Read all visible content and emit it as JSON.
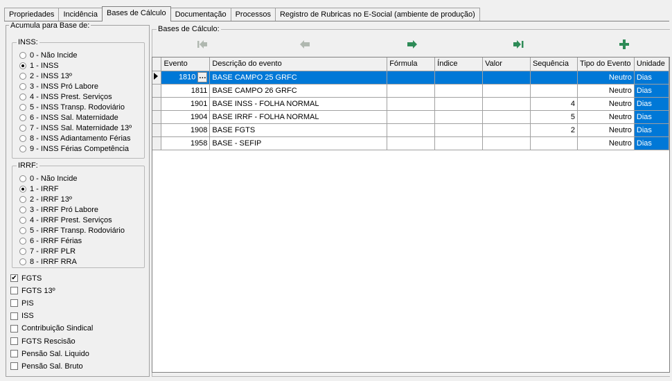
{
  "tabs": [
    {
      "label": "Propriedades"
    },
    {
      "label": "Incidência"
    },
    {
      "label": "Bases de Cálculo"
    },
    {
      "label": "Documentação"
    },
    {
      "label": "Processos"
    },
    {
      "label": "Registro de Rubricas no E-Social (ambiente de produção)"
    }
  ],
  "left": {
    "title": "Acumula para Base de:",
    "inss": {
      "title": "INSS:",
      "options": [
        "0 - Não Incide",
        "1 - INSS",
        "2 - INSS 13º",
        "3 - INSS Pró Labore",
        "4 - INSS Prest. Serviços",
        "5 - INSS Transp. Rodoviário",
        "6 - INSS Sal. Maternidade",
        "7 - INSS Sal. Maternidade 13º",
        "8 - INSS Adiantamento Férias",
        "9 - INSS Férias Competência"
      ],
      "selected": 1
    },
    "irrf": {
      "title": "IRRF:",
      "options": [
        "0 - Não Incide",
        "1 - IRRF",
        "2 - IRRF 13º",
        "3 - IRRF Pró Labore",
        "4 - IRRF Prest. Serviços",
        "5 - IRRF Transp. Rodoviário",
        "6 - IRRF Férias",
        "7 - IRRF PLR",
        "8 - IRRF RRA"
      ],
      "selected": 1
    },
    "checks": [
      {
        "label": "FGTS",
        "checked": true
      },
      {
        "label": "FGTS 13º",
        "checked": false
      },
      {
        "label": "PIS",
        "checked": false
      },
      {
        "label": "ISS",
        "checked": false
      },
      {
        "label": "Contribuição Sindical",
        "checked": false
      },
      {
        "label": "FGTS Rescisão",
        "checked": false
      },
      {
        "label": "Pensão Sal. Liquido",
        "checked": false
      },
      {
        "label": "Pensão Sal. Bruto",
        "checked": false
      }
    ]
  },
  "right": {
    "title": "Bases de Cálculo:",
    "nav_icons": [
      "first-record-icon",
      "prior-record-icon",
      "next-record-icon",
      "last-record-icon",
      "add-record-icon"
    ],
    "columns": [
      "Evento",
      "Descrição do evento",
      "Fórmula",
      "Índice",
      "Valor",
      "Sequência",
      "Tipo do Evento",
      "Unidade"
    ],
    "rows": [
      {
        "evento": "1810",
        "descricao": "BASE CAMPO 25 GRFC",
        "formula": "",
        "indice": "",
        "valor": "",
        "sequencia": "",
        "tipo": "Neutro",
        "unidade": "Dias"
      },
      {
        "evento": "1811",
        "descricao": "BASE CAMPO 26 GRFC",
        "formula": "",
        "indice": "",
        "valor": "",
        "sequencia": "",
        "tipo": "Neutro",
        "unidade": "Dias"
      },
      {
        "evento": "1901",
        "descricao": "BASE INSS - FOLHA NORMAL",
        "formula": "",
        "indice": "",
        "valor": "",
        "sequencia": "4",
        "tipo": "Neutro",
        "unidade": "Dias"
      },
      {
        "evento": "1904",
        "descricao": "BASE IRRF - FOLHA NORMAL",
        "formula": "",
        "indice": "",
        "valor": "",
        "sequencia": "5",
        "tipo": "Neutro",
        "unidade": "Dias"
      },
      {
        "evento": "1908",
        "descricao": "BASE FGTS",
        "formula": "",
        "indice": "",
        "valor": "",
        "sequencia": "2",
        "tipo": "Neutro",
        "unidade": "Dias"
      },
      {
        "evento": "1958",
        "descricao": "BASE - SEFIP",
        "formula": "",
        "indice": "",
        "valor": "",
        "sequencia": "",
        "tipo": "Neutro",
        "unidade": "Dias"
      }
    ],
    "selected_row": 0,
    "colors": {
      "selection": "#0078d7",
      "nav_icon": "#2e8b57",
      "nav_disabled": "#b0b8b0"
    }
  }
}
